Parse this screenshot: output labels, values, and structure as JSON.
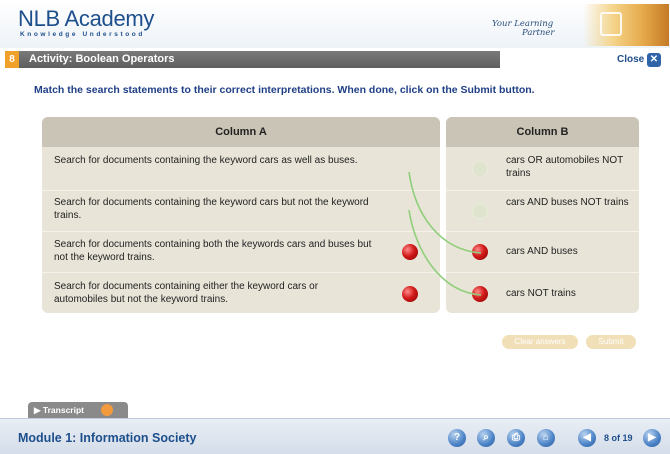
{
  "header": {
    "logo": "NLB Academy",
    "logo_sub": "Knowledge Understood",
    "tagline_line1": "Your Learning",
    "tagline_line2": "Partner"
  },
  "activity": {
    "number": "8",
    "title": "Activity: Boolean Operators",
    "close_label": "Close",
    "instructions": "Match the search statements to their correct interpretations. When done, click on the Submit button."
  },
  "table": {
    "column_a_header": "Column A",
    "column_b_header": "Column B",
    "column_a": [
      "Search for documents containing the keyword cars as well as buses.",
      "Search for documents containing the keyword cars but not the keyword trains.",
      "Search for documents containing both the keywords cars and buses but not the keyword trains.",
      "Search for documents containing either the keyword cars or automobiles but not the keyword trains."
    ],
    "column_b": [
      "cars OR automobiles NOT trains",
      "cars AND buses NOT trains",
      "cars AND buses",
      "cars NOT trains"
    ],
    "line_color": "#8fcf7a",
    "dot_color": "#d21a1a"
  },
  "buttons": {
    "clear_answers": "Clear answers",
    "submit": "Submit"
  },
  "transcript": {
    "label": "▶ Transcript"
  },
  "footer": {
    "module_title": "Module 1: Information Society",
    "page_indicator": "8 of 19",
    "icons": [
      "help-icon",
      "search-icon",
      "print-icon",
      "home-icon",
      "back-icon",
      "next-icon"
    ]
  }
}
